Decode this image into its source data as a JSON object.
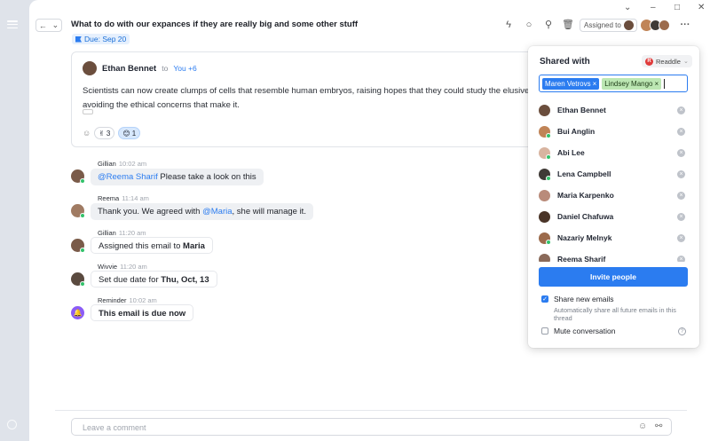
{
  "header": {
    "title": "What to do with our expances if they are really big and some other stuff",
    "due": "Due: Sep 20",
    "assigned_label": "Assigned to",
    "window_controls": [
      "minimize",
      "maximize",
      "close"
    ]
  },
  "email": {
    "sender": "Ethan Bennet",
    "to_label": "to",
    "recipients": "You +6",
    "body": "Scientists can now create clumps of cells that resemble human embryos, raising hopes that they could study the elusive first s",
    "body_line2": "avoiding the ethical concerns that make it.",
    "reactions": [
      {
        "emoji": "✌",
        "count": "3"
      },
      {
        "emoji": "😊",
        "count": "1"
      }
    ]
  },
  "messages": [
    {
      "author": "Gillian",
      "time": "10:02 am",
      "mention": "@Reema Sharif",
      "text": " Please take a look on this",
      "avatar_color": "#7a5b49"
    },
    {
      "author": "Reema",
      "time": "11:14 am",
      "prefix": "Thank you. We agreed with ",
      "mention": "@Maria",
      "text": ", she will manage it.",
      "avatar_color": "#a07b63"
    },
    {
      "author": "Gillian",
      "time": "11:20 am",
      "prefix": "Assigned this email to ",
      "bold": "Maria",
      "avatar_color": "#7a5b49"
    },
    {
      "author": "Wivvie",
      "time": "11:20 am",
      "prefix": "Set due date for ",
      "bold": "Thu, Oct, 13",
      "avatar_color": "#5a4a3f"
    },
    {
      "author": "Reminder",
      "time": "10:02 am",
      "bold": "This email is due now",
      "avatar_color": "#8b5cf6"
    }
  ],
  "comment": {
    "placeholder": "Leave a comment"
  },
  "share_panel": {
    "title": "Shared with",
    "workspace": "Readdle",
    "workspace_logo": "R",
    "chips": [
      {
        "label": "Maren Vetrovs",
        "color": "blue"
      },
      {
        "label": "Lindsey Mango",
        "color": "green"
      }
    ],
    "people": [
      {
        "name": "Ethan Bennet",
        "avatar_color": "#6b4e3d",
        "online": false
      },
      {
        "name": "Bui Anglin",
        "avatar_color": "#c08457",
        "online": true
      },
      {
        "name": "Abi Lee",
        "avatar_color": "#d8b4a0",
        "online": true
      },
      {
        "name": "Lena Campbell",
        "avatar_color": "#3f3a36",
        "online": true
      },
      {
        "name": "Maria Karpenko",
        "avatar_color": "#b98b7a",
        "online": false
      },
      {
        "name": "Daniel Chafuwa",
        "avatar_color": "#4a3528",
        "online": false
      },
      {
        "name": "Nazariy Melnyk",
        "avatar_color": "#9c6b4c",
        "online": true
      },
      {
        "name": "Reema Sharif",
        "avatar_color": "#8a6a5a",
        "online": false
      }
    ],
    "invite_label": "Invite people",
    "share_new_label": "Share new emails",
    "share_new_hint": "Automatically share all future emails in this thread",
    "share_new_checked": true,
    "mute_label": "Mute conversation",
    "mute_checked": false
  },
  "colors": {
    "accent": "#2b7cf0",
    "online": "#33c26b",
    "chip_green": "#bce7b3"
  }
}
